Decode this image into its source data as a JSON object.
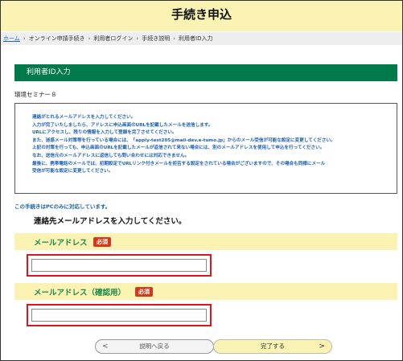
{
  "header": {
    "title": "手続き申込"
  },
  "breadcrumb": {
    "items": [
      "ホーム",
      "オンライン申請手続き",
      "利用者ログイン",
      "手続き説明",
      "利用者ID入力"
    ],
    "separator": "›"
  },
  "section": {
    "title": "利用者ID入力"
  },
  "program_name": "環境セミナー８",
  "notice": {
    "lines": [
      "連絡がとれるメールアドレスを入力してください。",
      "入力が完了いたしましたら、アドレスに申込画面のURLを記載したメールを送信します。",
      "URLにアクセスし、残りの情報を入力して登録を完了させてください。",
      "また、迷惑メール対策等を行っている場合には、「apply-test205@mail-dev.e-tumo.jp」からのメール受信が可能な設定に変更してください。",
      "上記の対策を行っても、申込画面のURLを記載したメールが返信されて来ない場合には、別のメールアドレスを使用して申込を行ってください。",
      "なお、送信元のメールアドレスに返信しても問い合わせには対応できません。",
      "最後に、携帯電話のメールでは、初期設定でURLリンク付きメールを拒否する設定をされている場合がございますので、その場合も同様にメール",
      "受信が可能な設定に変更してください。"
    ]
  },
  "pc_only": "この手続きはPCのみに対応しています。",
  "instruction": "連絡先メールアドレスを入力してください。",
  "fields": {
    "email": {
      "label": "メールアドレス",
      "required": "必須",
      "value": ""
    },
    "email_confirm": {
      "label": "メールアドレス（確認用）",
      "required": "必須",
      "value": ""
    }
  },
  "buttons": {
    "back": {
      "label": "説明へ戻る",
      "arrow": "<"
    },
    "next": {
      "label": "完了する",
      "arrow": ">"
    }
  },
  "colors": {
    "header_bg": "#fbf3b4",
    "section_bar": "#007a4b",
    "required_badge": "#d23a1c",
    "highlight_border": "#e0141c",
    "notice_text": "#1a5fb4"
  }
}
